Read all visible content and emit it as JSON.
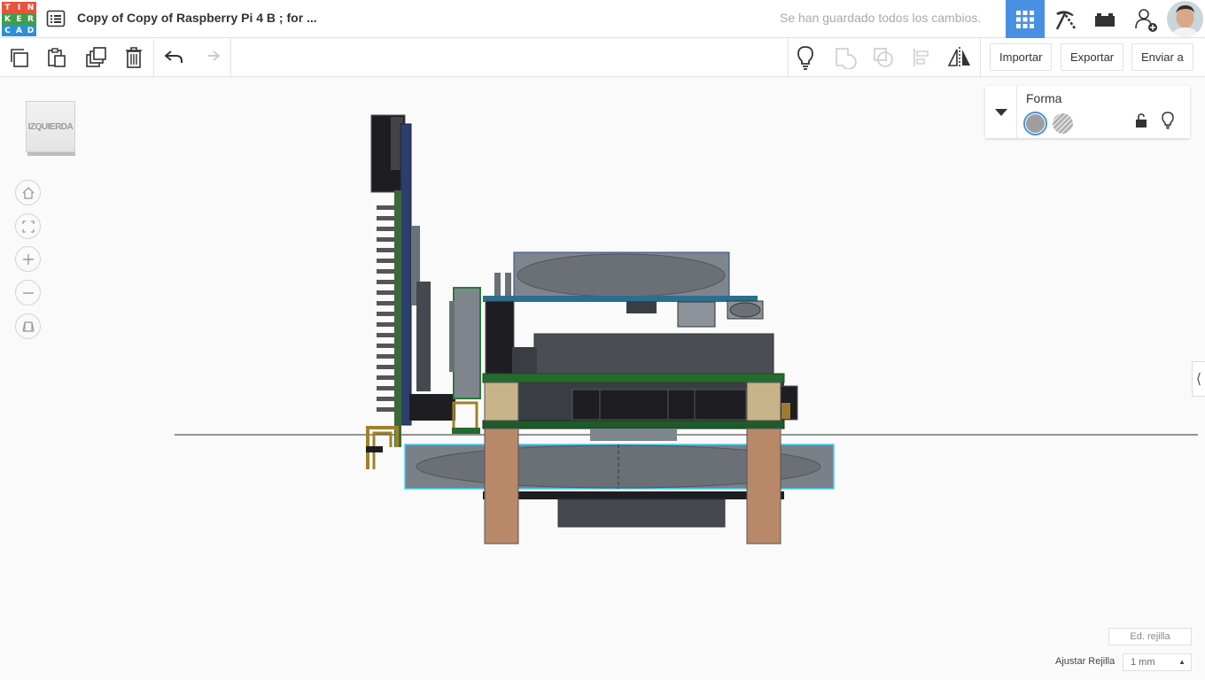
{
  "logo": {
    "letters": [
      "T",
      "I",
      "N",
      "K",
      "E",
      "R",
      "C",
      "A",
      "D"
    ],
    "colors": [
      "#e8523e",
      "#e8523e",
      "#e8523e",
      "#3f9e48",
      "#3f9e48",
      "#3f9e48",
      "#2d8fd6",
      "#2d8fd6",
      "#2d8fd6"
    ]
  },
  "header": {
    "title": "Copy of Copy of Raspberry Pi 4 B ; for ...",
    "save_status": "Se han guardado todos los cambios.",
    "accent": "#4a90e2"
  },
  "toolbar": {
    "import_label": "Importar",
    "export_label": "Exportar",
    "send_label": "Enviar a"
  },
  "view_cube": {
    "label": "IZQUIERDA"
  },
  "shape_panel": {
    "title": "Forma"
  },
  "grid": {
    "edit_label": "Ed. rejilla",
    "snap_label": "Ajustar Rejilla",
    "snap_value": "1 mm"
  }
}
